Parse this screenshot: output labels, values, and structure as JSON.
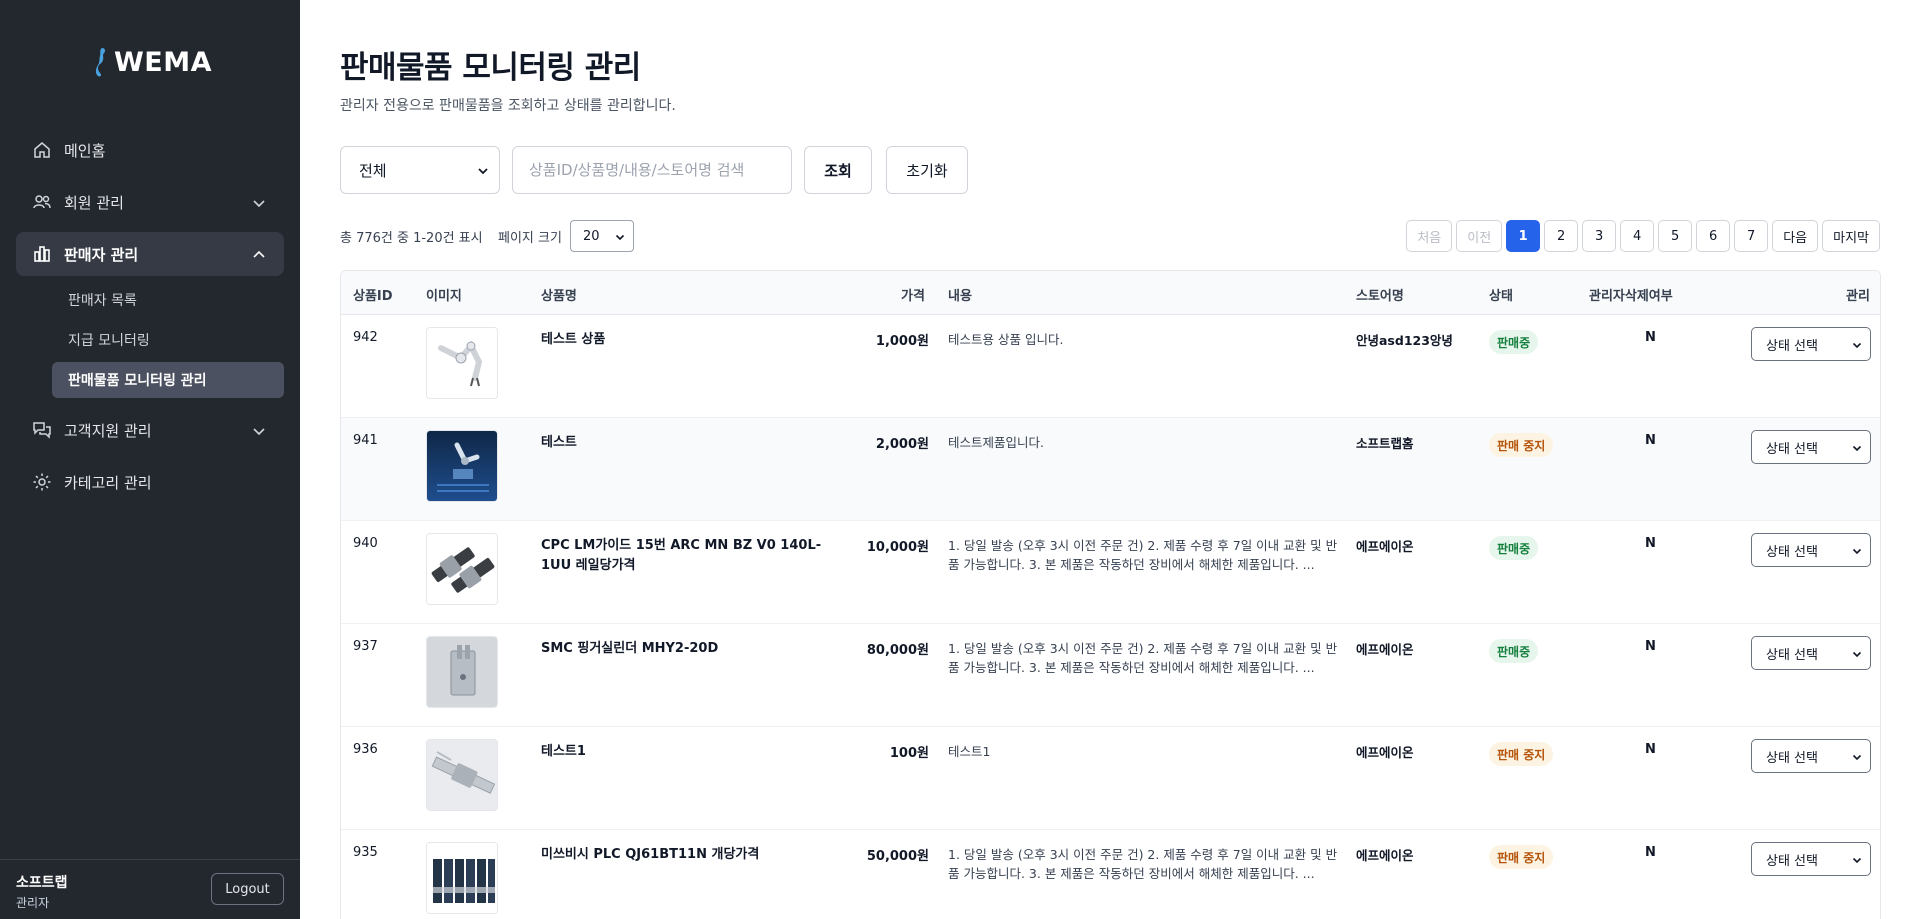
{
  "brand": {
    "logo_text": "WEMA"
  },
  "sidebar": {
    "items": [
      {
        "label": "메인홈"
      },
      {
        "label": "회원 관리"
      },
      {
        "label": "판매자 관리"
      },
      {
        "label": "고객지원 관리"
      },
      {
        "label": "카테고리 관리"
      }
    ],
    "sub_items": [
      {
        "label": "판매자 목록"
      },
      {
        "label": "지급 모니터링"
      },
      {
        "label": "판매물품 모니터링 관리"
      }
    ],
    "user_name": "소프트랩",
    "user_role": "관리자",
    "logout_label": "Logout"
  },
  "page": {
    "title": "판매물품 모니터링 관리",
    "description": "관리자 전용으로 판매물품을 조회하고 상태를 관리합니다."
  },
  "filter": {
    "select_value": "전체",
    "search_placeholder": "상품ID/상품명/내용/스토어명 검색",
    "query_label": "조회",
    "reset_label": "초기화"
  },
  "info": {
    "total_text": "총 776건 중 1-20건 표시",
    "page_size_label": "페이지 크기",
    "page_size_value": "20"
  },
  "pagination": {
    "first": "처음",
    "prev": "이전",
    "pages": [
      "1",
      "2",
      "3",
      "4",
      "5",
      "6",
      "7"
    ],
    "current": "1",
    "next": "다음",
    "last": "마지막"
  },
  "table": {
    "headers": {
      "id": "상품ID",
      "image": "이미지",
      "name": "상품명",
      "price": "가격",
      "content": "내용",
      "store": "스토어명",
      "status": "상태",
      "admin_deleted": "관리자삭제여부",
      "manage": "관리"
    },
    "manage_select_label": "상태 선택",
    "rows": [
      {
        "id": "942",
        "name": "테스트 상품",
        "price": "1,000원",
        "content": "테스트용 상품 입니다.",
        "store": "안녕asd123앙녕",
        "status": "판매중",
        "admin_deleted": "N"
      },
      {
        "id": "941",
        "name": "테스트",
        "price": "2,000원",
        "content": "테스트제품입니다.",
        "store": "소프트랩홈",
        "status": "판매 중지",
        "admin_deleted": "N"
      },
      {
        "id": "940",
        "name": "CPC LM가이드 15번 ARC MN BZ V0 140L-1UU 레일당가격",
        "price": "10,000원",
        "content": "1. 당일 발송 (오후 3시 이전 주문 건) 2. 제품 수령 후 7일 이내 교환 및 반품 가능합니다. 3. 본 제품은 작동하던 장비에서 해체한 제품입니다. ...",
        "store": "에프에이온",
        "status": "판매중",
        "admin_deleted": "N"
      },
      {
        "id": "937",
        "name": "SMC 핑거실린더 MHY2-20D",
        "price": "80,000원",
        "content": "1. 당일 발송 (오후 3시 이전 주문 건) 2. 제품 수령 후 7일 이내 교환 및 반품 가능합니다. 3. 본 제품은 작동하던 장비에서 해체한 제품입니다. ...",
        "store": "에프에이온",
        "status": "판매중",
        "admin_deleted": "N"
      },
      {
        "id": "936",
        "name": "테스트1",
        "price": "100원",
        "content": "테스트1",
        "store": "에프에이온",
        "status": "판매 중지",
        "admin_deleted": "N"
      },
      {
        "id": "935",
        "name": "미쓰비시 PLC QJ61BT11N 개당가격",
        "price": "50,000원",
        "content": "1. 당일 발송 (오후 3시 이전 주문 건) 2. 제품 수령 후 7일 이내 교환 및 반품 가능합니다. 3. 본 제품은 작동하던 장비에서 해체한 제품입니다. ...",
        "store": "에프에이온",
        "status": "판매 중지",
        "admin_deleted": "N"
      }
    ]
  },
  "colors": {
    "sidebar_bg": "#23272e",
    "accent": "#2563eb",
    "status_on": "#15803d",
    "status_off": "#b45309"
  }
}
